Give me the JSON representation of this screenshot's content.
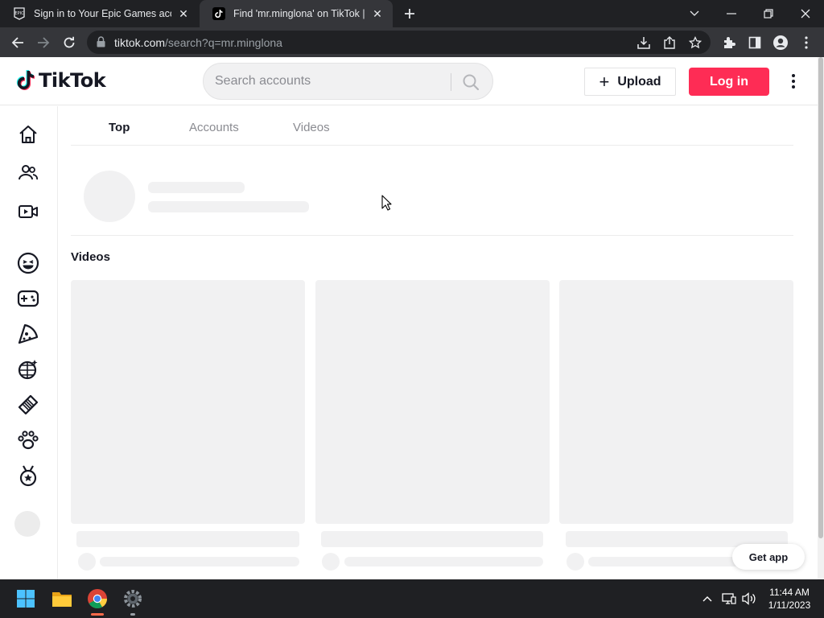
{
  "browser": {
    "tabs": [
      {
        "title": "Sign in to Your Epic Games accou",
        "favicon": "epic-games-icon",
        "active": false
      },
      {
        "title": "Find 'mr.minglona' on TikTok | Tik",
        "favicon": "tiktok-icon",
        "active": true
      }
    ],
    "url_host": "tiktok.com",
    "url_path": "/search?q=mr.minglona"
  },
  "tiktok": {
    "logo_text": "TikTok",
    "search_placeholder": "Search accounts",
    "upload_label": "Upload",
    "upload_plus": "+",
    "login_label": "Log in",
    "brand_color": "#fe2c55"
  },
  "sidebar": {
    "icons": [
      "home-icon",
      "following-icon",
      "live-icon",
      "comedy-icon",
      "gaming-icon",
      "food-icon",
      "dance-icon",
      "beauty-icon",
      "animals-icon",
      "sports-icon"
    ]
  },
  "main": {
    "tabs": [
      {
        "label": "Top",
        "active": true
      },
      {
        "label": "Accounts",
        "active": false
      },
      {
        "label": "Videos",
        "active": false
      }
    ],
    "videos_heading": "Videos",
    "get_app_label": "Get app"
  },
  "taskbar": {
    "apps": [
      "windows-start-icon",
      "file-explorer-icon",
      "chrome-icon",
      "settings-icon"
    ],
    "time": "11:44 AM",
    "date": "1/11/2023"
  }
}
